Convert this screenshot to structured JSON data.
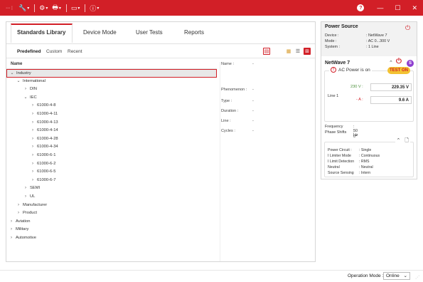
{
  "colors": {
    "accent": "#d21f27",
    "badge": "#8e3fd0",
    "test_on": "#f3c232"
  },
  "tabs": [
    "Standards Library",
    "Device Mode",
    "User Tests",
    "Reports"
  ],
  "subtabs": [
    "Predefined",
    "Custom",
    "Recent"
  ],
  "tree_header": "Name",
  "tree": [
    {
      "label": "Industry",
      "level": 0,
      "chevron": "v",
      "selected": true
    },
    {
      "label": "International",
      "level": 1,
      "chevron": "v"
    },
    {
      "label": "DIN",
      "level": 2,
      "chevron": ">"
    },
    {
      "label": "IEC",
      "level": 2,
      "chevron": "v"
    },
    {
      "label": "61000-4-8",
      "level": 3,
      "chevron": ">"
    },
    {
      "label": "61000-4-11",
      "level": 3,
      "chevron": ">"
    },
    {
      "label": "61000-4-13",
      "level": 3,
      "chevron": ">"
    },
    {
      "label": "61000-4-14",
      "level": 3,
      "chevron": ">"
    },
    {
      "label": "61000-4-28",
      "level": 3,
      "chevron": ">"
    },
    {
      "label": "61000-4-34",
      "level": 3,
      "chevron": ">"
    },
    {
      "label": "61000-6-1",
      "level": 3,
      "chevron": ">"
    },
    {
      "label": "61000-6-2",
      "level": 3,
      "chevron": ">"
    },
    {
      "label": "61000-6-5",
      "level": 3,
      "chevron": ">"
    },
    {
      "label": "61000-6-7",
      "level": 3,
      "chevron": ">"
    },
    {
      "label": "SEMI",
      "level": 2,
      "chevron": ">"
    },
    {
      "label": "UL",
      "level": 2,
      "chevron": ">"
    },
    {
      "label": "Manufacturer",
      "level": 1,
      "chevron": ">"
    },
    {
      "label": "Product",
      "level": 1,
      "chevron": ">"
    },
    {
      "label": "Aviation",
      "level": 0,
      "chevron": ">"
    },
    {
      "label": "Military",
      "level": 0,
      "chevron": ">"
    },
    {
      "label": "Automotive",
      "level": 0,
      "chevron": ">"
    }
  ],
  "details": [
    {
      "label": "Name :",
      "value": "-"
    },
    {
      "label": "Phenomenon :",
      "value": "-"
    },
    {
      "label": "Type :",
      "value": "-"
    },
    {
      "label": "Duration :",
      "value": "-"
    },
    {
      "label": "Line :",
      "value": "-"
    },
    {
      "label": "Cycles :",
      "value": "-"
    }
  ],
  "power_source": {
    "title": "Power Source",
    "rows": [
      {
        "label": "Device :",
        "value": ": NetWave 7"
      },
      {
        "label": "Mode :",
        "value": ": AC 0...300 V"
      },
      {
        "label": "System :",
        "value": ": 1 Line"
      }
    ]
  },
  "netwave": {
    "title": "NetWave 7",
    "badge": "S",
    "ac_status": "AC Power is on",
    "test_label": "TEST ON",
    "line_label": "Line 1",
    "voltage_label": "230 V :",
    "voltage_value": "229.35 V",
    "current_label": "- A :",
    "current_value": "9.6 A",
    "rows": [
      {
        "label": "Frequency",
        "value": ": 50 Hz"
      },
      {
        "label": "Phase Shifts",
        "value": ": 0°"
      }
    ],
    "circuit": [
      {
        "label": "Power Circuit :",
        "value": ": Single"
      },
      {
        "label": "I Limiter Mode",
        "value": ": Continuous"
      },
      {
        "label": "I Limit Detection",
        "value": ": RMS"
      },
      {
        "label": "Neutral",
        "value": ": Neutral"
      },
      {
        "label": "Source Sensing",
        "value": ": Intern"
      }
    ]
  },
  "status": {
    "op_mode_label": "Operation Mode :",
    "op_mode_value": "Online"
  }
}
